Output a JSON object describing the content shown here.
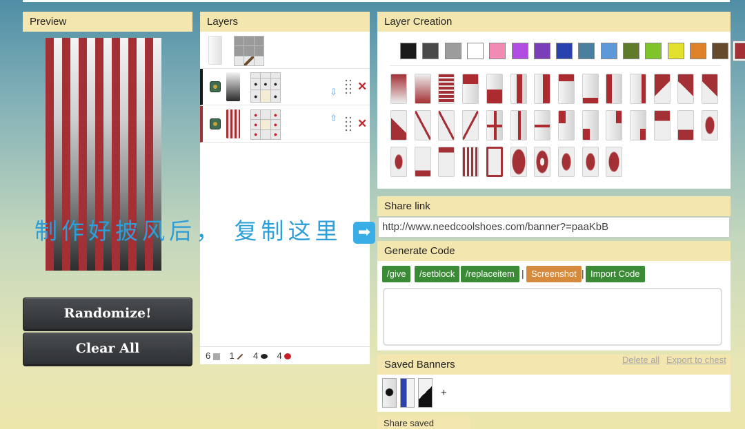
{
  "preview": {
    "title": "Preview"
  },
  "buttons": {
    "randomize": "Randomize!",
    "clear": "Clear All"
  },
  "layers": {
    "title": "Layers",
    "rows": [
      {
        "swatch_color": "#ececec",
        "grid_items": [
          "block",
          "block",
          "block",
          "block",
          "block",
          "block",
          "",
          "stick",
          ""
        ]
      },
      {
        "swatch_color": "#7a7a7a",
        "grid_items": [
          "",
          "",
          "",
          "ink",
          "ink",
          "ink",
          "ink",
          "banner",
          "ink"
        ]
      },
      {
        "swatch_color": "#a33035",
        "grid_items": [
          "dye",
          "",
          "dye",
          "dye",
          "banner",
          "dye",
          "dye",
          "",
          "dye"
        ]
      }
    ],
    "counts": [
      {
        "value": "6",
        "icon": "wool-block-icon"
      },
      {
        "value": "1",
        "icon": "stick-icon"
      },
      {
        "value": "4",
        "icon": "ink-sac-icon"
      },
      {
        "value": "4",
        "icon": "red-dye-icon"
      }
    ]
  },
  "layer_creation": {
    "title": "Layer Creation",
    "colors": [
      "#1a1a1a",
      "#4a4a4a",
      "#9c9c9c",
      "#ffffff",
      "#f08cb4",
      "#b04ce0",
      "#7a3fb8",
      "#2a42ae",
      "#4a7fa0",
      "#5d98d8",
      "#5e7a2a",
      "#7fc42a",
      "#e2df2d",
      "#e0822a",
      "#664a2e",
      "#a33035"
    ],
    "selected_color_index": 15,
    "accent_color": "#a33035"
  },
  "share": {
    "title": "Share link",
    "url": "http://www.needcoolshoes.com/banner?=paaKbB"
  },
  "code": {
    "title": "Generate Code",
    "buttons": [
      "/give",
      "/setblock",
      "/replaceitem",
      "Screenshot",
      "Import Code"
    ],
    "separator": "|"
  },
  "saved": {
    "title": "Saved Banners",
    "delete_all": "Delete all",
    "export": "Export to chest",
    "add": "+",
    "share_label": "Share saved banners:"
  },
  "watermark": {
    "text": "制作好披风后， 复制这里",
    "arrow": "➡"
  }
}
